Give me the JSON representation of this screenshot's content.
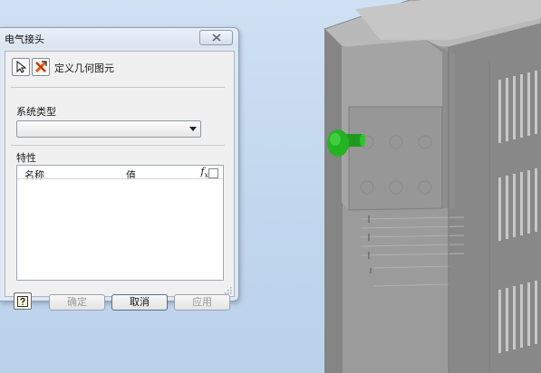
{
  "dialog": {
    "title": "电气接头",
    "define_geometry_label": "定义几何图元",
    "system_type": {
      "label": "系统类型",
      "value": ""
    },
    "properties": {
      "label": "特性",
      "col_name": "名称",
      "col_value": "值",
      "fx_symbol": "f",
      "fx_subscript": "x"
    },
    "buttons": {
      "ok": "确定",
      "cancel": "取消",
      "apply": "应用"
    }
  },
  "colors": {
    "viewport_bg": "#c6dbf0",
    "connector": "#22b022",
    "cabinet": "#8d8d8d"
  },
  "icons": [
    "select-arrow-icon",
    "geometry-icon",
    "close-icon",
    "help-icon",
    "dropdown-arrow-icon",
    "resize-grip-icon"
  ]
}
